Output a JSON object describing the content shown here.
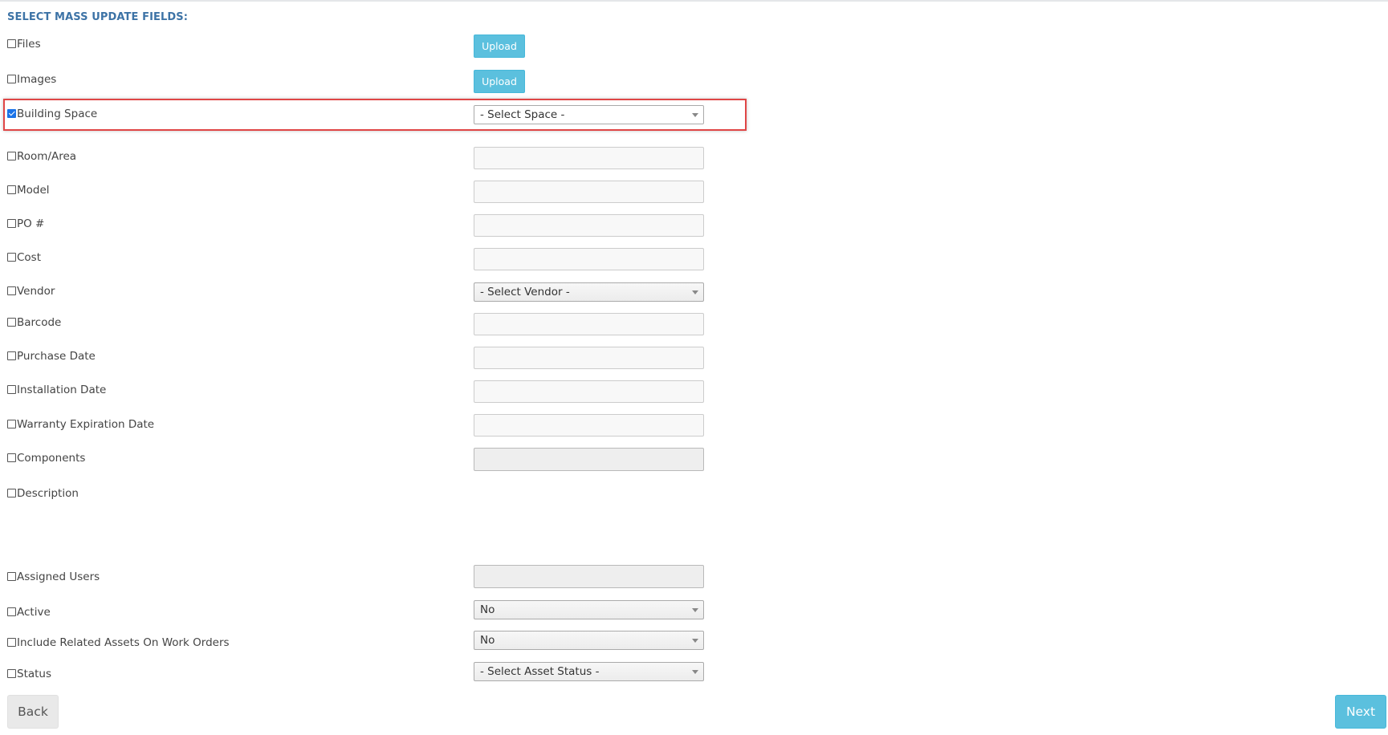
{
  "heading": "SELECT MASS UPDATE FIELDS:",
  "fields": {
    "files": {
      "label": "Files",
      "checked": false,
      "button": "Upload"
    },
    "images": {
      "label": "Images",
      "checked": false,
      "button": "Upload"
    },
    "building_space": {
      "label": "Building Space",
      "checked": true,
      "select_value": "- Select Space -"
    },
    "room_area": {
      "label": "Room/Area",
      "checked": false,
      "value": ""
    },
    "model": {
      "label": "Model",
      "checked": false,
      "value": ""
    },
    "po": {
      "label": "PO #",
      "checked": false,
      "value": ""
    },
    "cost": {
      "label": "Cost",
      "checked": false,
      "value": ""
    },
    "vendor": {
      "label": "Vendor",
      "checked": false,
      "select_value": "- Select Vendor -"
    },
    "barcode": {
      "label": "Barcode",
      "checked": false,
      "value": ""
    },
    "purchase_date": {
      "label": "Purchase Date",
      "checked": false,
      "value": ""
    },
    "installation_date": {
      "label": "Installation Date",
      "checked": false,
      "value": ""
    },
    "warranty_expiration_date": {
      "label": "Warranty Expiration Date",
      "checked": false,
      "value": ""
    },
    "components": {
      "label": "Components",
      "checked": false,
      "value": ""
    },
    "description": {
      "label": "Description",
      "checked": false
    },
    "assigned_users": {
      "label": "Assigned Users",
      "checked": false,
      "value": ""
    },
    "active": {
      "label": "Active",
      "checked": false,
      "select_value": "No"
    },
    "include_related_assets": {
      "label": "Include Related Assets On Work Orders",
      "checked": false,
      "select_value": "No"
    },
    "status": {
      "label": "Status",
      "checked": false,
      "select_value": "- Select Asset Status -"
    }
  },
  "footer": {
    "back_label": "Back",
    "next_label": "Next"
  },
  "colors": {
    "heading": "#3d73a6",
    "info_button": "#5bc0de",
    "highlight_border": "#e04646",
    "checkbox_checked": "#1a73e8"
  },
  "icons": {
    "select_caret": "chevron-down-icon"
  }
}
